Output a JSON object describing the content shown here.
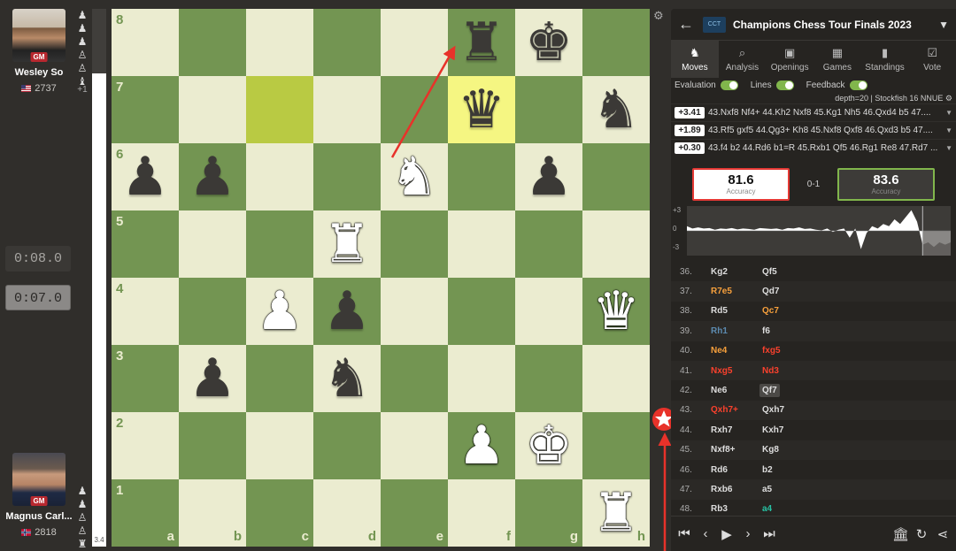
{
  "top_player": {
    "name": "Wesley So",
    "rating": "2737",
    "title": "GM",
    "advantage": "+1",
    "captures": [
      "♟",
      "♟",
      "♟",
      "♙",
      "♙",
      "♝"
    ]
  },
  "bottom_player": {
    "name": "Magnus Carl...",
    "rating": "2818",
    "title": "GM",
    "captures": [
      "♟",
      "♟",
      "♙",
      "♙",
      "♜"
    ]
  },
  "clocks": {
    "top": "0:08.0",
    "bottom": "0:07.0"
  },
  "eval_bar": {
    "label": "3.4",
    "white_fraction": 0.88
  },
  "board": {
    "ranks": [
      "8",
      "7",
      "6",
      "5",
      "4",
      "3",
      "2",
      "1"
    ],
    "files": [
      "a",
      "b",
      "c",
      "d",
      "e",
      "f",
      "g",
      "h"
    ],
    "pieces": [
      {
        "sq": "f8",
        "glyph": "♜",
        "color": "b",
        "name": "black-rook"
      },
      {
        "sq": "g8",
        "glyph": "♚",
        "color": "b",
        "name": "black-king"
      },
      {
        "sq": "f7",
        "glyph": "♛",
        "color": "b",
        "name": "black-queen"
      },
      {
        "sq": "h7",
        "glyph": "♞",
        "color": "b",
        "name": "black-knight"
      },
      {
        "sq": "a6",
        "glyph": "♟",
        "color": "b",
        "name": "black-pawn"
      },
      {
        "sq": "b6",
        "glyph": "♟",
        "color": "b",
        "name": "black-pawn"
      },
      {
        "sq": "e6",
        "glyph": "♞",
        "color": "w",
        "name": "white-knight"
      },
      {
        "sq": "g6",
        "glyph": "♟",
        "color": "b",
        "name": "black-pawn"
      },
      {
        "sq": "d5",
        "glyph": "♜",
        "color": "w",
        "name": "white-rook"
      },
      {
        "sq": "c4",
        "glyph": "♟",
        "color": "w",
        "name": "white-pawn"
      },
      {
        "sq": "d4",
        "glyph": "♟",
        "color": "b",
        "name": "black-pawn"
      },
      {
        "sq": "h4",
        "glyph": "♛",
        "color": "w",
        "name": "white-queen"
      },
      {
        "sq": "b3",
        "glyph": "♟",
        "color": "b",
        "name": "black-pawn"
      },
      {
        "sq": "d3",
        "glyph": "♞",
        "color": "b",
        "name": "black-knight"
      },
      {
        "sq": "f2",
        "glyph": "♟",
        "color": "w",
        "name": "white-pawn"
      },
      {
        "sq": "g2",
        "glyph": "♚",
        "color": "w",
        "name": "white-king"
      },
      {
        "sq": "h1",
        "glyph": "♜",
        "color": "w",
        "name": "white-rook"
      }
    ],
    "highlights": [
      "c7",
      "f7"
    ]
  },
  "panel": {
    "title": "Champions Chess Tour Finals 2023",
    "logo_text": "CCT",
    "tabs": [
      {
        "label": "Moves",
        "icon": "♞",
        "active": true
      },
      {
        "label": "Analysis",
        "icon": "⌕",
        "active": false
      },
      {
        "label": "Openings",
        "icon": "▣",
        "active": false
      },
      {
        "label": "Games",
        "icon": "▦",
        "active": false
      },
      {
        "label": "Standings",
        "icon": "▮",
        "active": false
      },
      {
        "label": "Vote",
        "icon": "☑",
        "active": false
      }
    ],
    "toggles": {
      "evaluation": "Evaluation",
      "lines": "Lines",
      "feedback": "Feedback"
    },
    "depth": "depth=20 | Stockfish 16 NNUE",
    "engine_lines": [
      {
        "eval": "+3.41",
        "text": "43.Nxf8 Nf4+ 44.Kh2 Nxf8 45.Kg1 Nh5 46.Qxd4 b5 47...."
      },
      {
        "eval": "+1.89",
        "text": "43.Rf5 gxf5 44.Qg3+ Kh8 45.Nxf8 Qxf8 46.Qxd3 b5 47...."
      },
      {
        "eval": "+0.30",
        "text": "43.f4 b2 44.Rd6 b1=R 45.Rxb1 Qf5 46.Rg1 Re8 47.Rd7 ..."
      }
    ],
    "accuracy": {
      "white": "81.6",
      "black": "83.6",
      "label": "Accuracy",
      "result": "0-1"
    },
    "graph_labels": [
      "+3",
      "0",
      "-3"
    ],
    "graph_values": [
      0.2,
      0.1,
      0.15,
      0.1,
      0.12,
      0.05,
      0.1,
      0.08,
      0.12,
      0.06,
      0.1,
      0.08,
      0.05,
      0.12,
      0.1,
      0.08,
      0.1,
      0.05,
      0.12,
      0.1,
      0.15,
      0.08,
      0.1,
      0.05,
      0.02,
      0.1,
      -0.05,
      0.05,
      0.1,
      -0.3,
      0.1,
      -0.8,
      -0.1,
      0.2,
      0.1,
      0.3,
      0.2,
      0.5,
      0.3,
      0.6,
      0.9,
      0.4,
      -0.6,
      -0.5,
      -0.7,
      -0.5,
      -0.6,
      -0.5
    ],
    "moves": [
      {
        "n": "36.",
        "w": "Kg2",
        "b": "Qf5"
      },
      {
        "n": "37.",
        "w": "R7e5",
        "b": "Qd7",
        "wc": "orange"
      },
      {
        "n": "38.",
        "w": "Rd5",
        "b": "Qc7",
        "bc": "orange"
      },
      {
        "n": "39.",
        "w": "Rh1",
        "b": "f6",
        "wc": "blue"
      },
      {
        "n": "40.",
        "w": "Ne4",
        "b": "fxg5",
        "wc": "orange",
        "bc": "red"
      },
      {
        "n": "41.",
        "w": "Nxg5",
        "b": "Nd3",
        "wc": "red",
        "bc": "red"
      },
      {
        "n": "42.",
        "w": "Ne6",
        "b": "Qf7",
        "bcur": true
      },
      {
        "n": "43.",
        "w": "Qxh7+",
        "b": "Qxh7",
        "wc": "red"
      },
      {
        "n": "44.",
        "w": "Rxh7",
        "b": "Kxh7"
      },
      {
        "n": "45.",
        "w": "Nxf8+",
        "b": "Kg8"
      },
      {
        "n": "46.",
        "w": "Rd6",
        "b": "b2"
      },
      {
        "n": "47.",
        "w": "Rxb6",
        "b": "a5"
      },
      {
        "n": "48.",
        "w": "Rb3",
        "b": "a4",
        "bc": "green"
      }
    ]
  }
}
